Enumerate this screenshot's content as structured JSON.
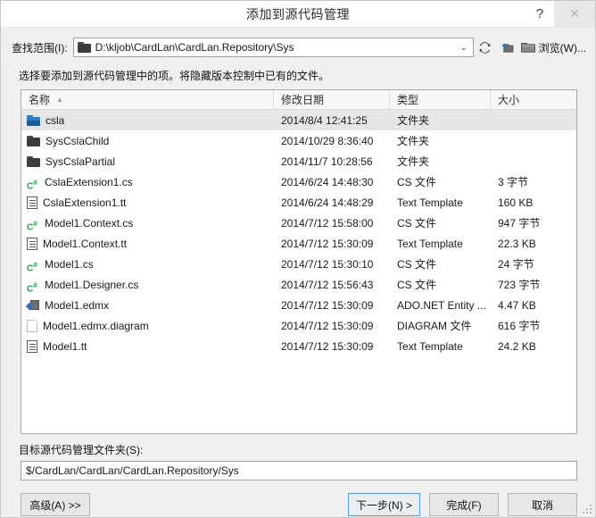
{
  "window": {
    "title": "添加到源代码管理",
    "help_label": "?",
    "close_label": "✕"
  },
  "lookin": {
    "label": "查找范围(I):",
    "path": "D:\\kljob\\CardLan\\CardLan.Repository\\Sys",
    "dropdown_arrow": "⌄",
    "browse_label": "浏览(W)..."
  },
  "instruction": "选择要添加到源代码管理中的项。将隐藏版本控制中已有的文件。",
  "filelist": {
    "columns": [
      {
        "label": "名称",
        "sort": "▲"
      },
      {
        "label": "修改日期",
        "sort": ""
      },
      {
        "label": "类型",
        "sort": ""
      },
      {
        "label": "大小",
        "sort": ""
      }
    ],
    "rows": [
      {
        "icon": "folder-blue-icon",
        "name": "csla",
        "date": "2014/8/4 12:41:25",
        "type": "文件夹",
        "size": "",
        "selected": true
      },
      {
        "icon": "folder-icon",
        "name": "SysCslaChild",
        "date": "2014/10/29 8:36:40",
        "type": "文件夹",
        "size": "",
        "selected": false
      },
      {
        "icon": "folder-icon",
        "name": "SysCslaPartial",
        "date": "2014/11/7 10:28:56",
        "type": "文件夹",
        "size": "",
        "selected": false
      },
      {
        "icon": "csharp-file-icon",
        "name": "CslaExtension1.cs",
        "date": "2014/6/24 14:48:30",
        "type": "CS 文件",
        "size": "3 字节",
        "selected": false
      },
      {
        "icon": "text-template-icon",
        "name": "CslaExtension1.tt",
        "date": "2014/6/24 14:48:29",
        "type": "Text Template",
        "size": "160 KB",
        "selected": false
      },
      {
        "icon": "csharp-file-icon",
        "name": "Model1.Context.cs",
        "date": "2014/7/12 15:58:00",
        "type": "CS 文件",
        "size": "947 字节",
        "selected": false
      },
      {
        "icon": "text-template-icon",
        "name": "Model1.Context.tt",
        "date": "2014/7/12 15:30:09",
        "type": "Text Template",
        "size": "22.3 KB",
        "selected": false
      },
      {
        "icon": "csharp-file-icon",
        "name": "Model1.cs",
        "date": "2014/7/12 15:30:10",
        "type": "CS 文件",
        "size": "24 字节",
        "selected": false
      },
      {
        "icon": "csharp-file-icon",
        "name": "Model1.Designer.cs",
        "date": "2014/7/12 15:56:43",
        "type": "CS 文件",
        "size": "723 字节",
        "selected": false
      },
      {
        "icon": "edmx-file-icon",
        "name": "Model1.edmx",
        "date": "2014/7/12 15:30:09",
        "type": "ADO.NET Entity ...",
        "size": "4.47 KB",
        "selected": false
      },
      {
        "icon": "blank-file-icon",
        "name": "Model1.edmx.diagram",
        "date": "2014/7/12 15:30:09",
        "type": "DIAGRAM 文件",
        "size": "616 字节",
        "selected": false
      },
      {
        "icon": "text-template-icon",
        "name": "Model1.tt",
        "date": "2014/7/12 15:30:09",
        "type": "Text Template",
        "size": "24.2 KB",
        "selected": false
      }
    ]
  },
  "target": {
    "label": "目标源代码管理文件夹(S):",
    "value": "$/CardLan/CardLan/CardLan.Repository/Sys"
  },
  "buttons": {
    "advanced": "高级(A) >>",
    "next": "下一步(N) >",
    "finish": "完成(F)",
    "cancel": "取消"
  },
  "colors": {
    "focus_border": "#4f9fd6",
    "selected_row": "#e6e6e6",
    "csharp_green": "#1d9e4a",
    "folder_blue": "#2b7fc4"
  }
}
